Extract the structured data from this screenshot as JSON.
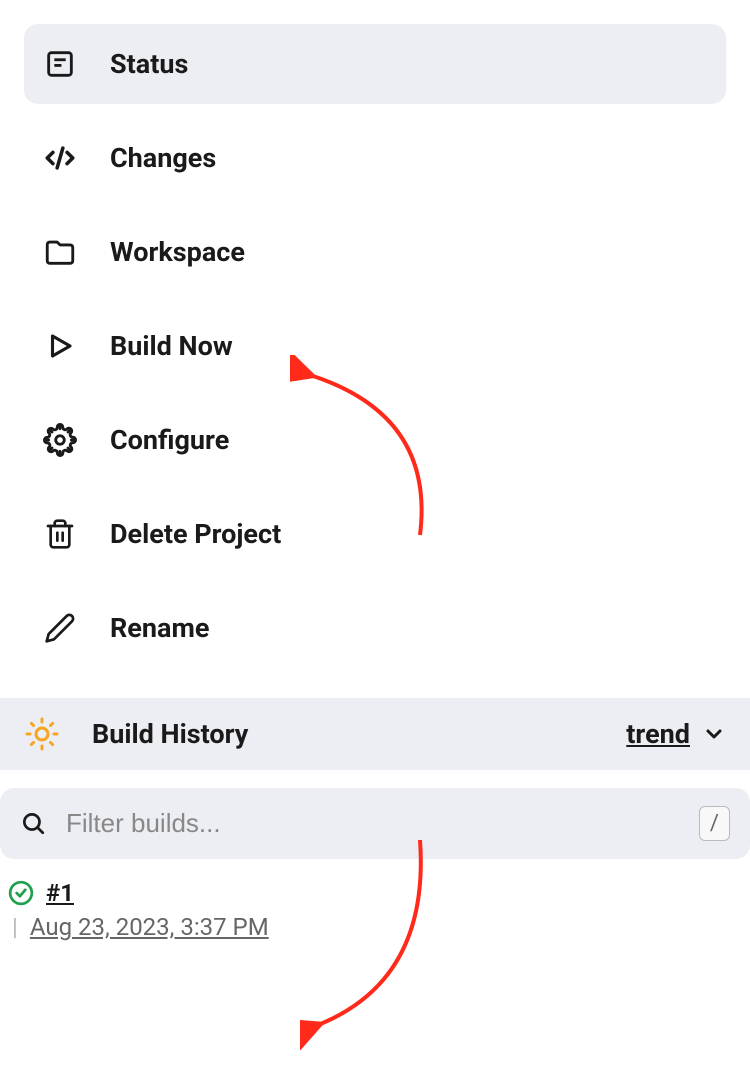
{
  "sidebar": {
    "items": [
      {
        "label": "Status",
        "icon": "status-icon",
        "active": true
      },
      {
        "label": "Changes",
        "icon": "code-icon",
        "active": false
      },
      {
        "label": "Workspace",
        "icon": "folder-icon",
        "active": false
      },
      {
        "label": "Build Now",
        "icon": "play-icon",
        "active": false
      },
      {
        "label": "Configure",
        "icon": "gear-icon",
        "active": false
      },
      {
        "label": "Delete Project",
        "icon": "trash-icon",
        "active": false
      },
      {
        "label": "Rename",
        "icon": "pencil-icon",
        "active": false
      }
    ]
  },
  "buildHistory": {
    "title": "Build History",
    "trendLabel": "trend",
    "filterPlaceholder": "Filter builds...",
    "shortcutKey": "/",
    "builds": [
      {
        "number": "#1",
        "date": "Aug 23, 2023, 3:37 PM",
        "status": "success"
      }
    ]
  }
}
